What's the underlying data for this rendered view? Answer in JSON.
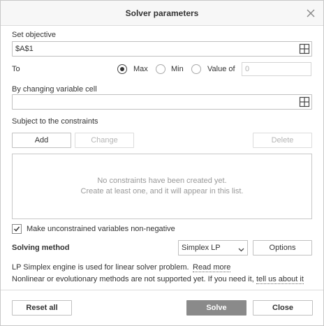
{
  "dialog": {
    "title": "Solver parameters"
  },
  "objective": {
    "label": "Set objective",
    "value": "$A$1"
  },
  "to": {
    "label": "To",
    "options": [
      {
        "label": "Max",
        "selected": true
      },
      {
        "label": "Min",
        "selected": false
      },
      {
        "label": "Value of",
        "selected": false
      }
    ],
    "value_of": "0"
  },
  "variables": {
    "label": "By changing variable cell",
    "value": ""
  },
  "constraints": {
    "label": "Subject to the constraints",
    "add_label": "Add",
    "change_label": "Change",
    "delete_label": "Delete",
    "empty_line1": "No constraints have been created yet.",
    "empty_line2": "Create at least one, and it will appear in this list."
  },
  "nonnegative": {
    "label": "Make unconstrained variables non-negative",
    "checked": true
  },
  "method": {
    "label": "Solving method",
    "selected": "Simplex LP",
    "options_label": "Options"
  },
  "info": {
    "line1": "LP Simplex engine is used for linear solver problem.",
    "read_more": "Read more",
    "line2": "Nonlinear or evolutionary methods are not supported yet. If you need it,",
    "tell_us": "tell us about it"
  },
  "footer": {
    "reset_label": "Reset all",
    "solve_label": "Solve",
    "close_label": "Close"
  },
  "colors": {
    "solve_button": "#8a8a8a",
    "title_bar": "#f7f7f7",
    "border": "#c0c0c0"
  }
}
